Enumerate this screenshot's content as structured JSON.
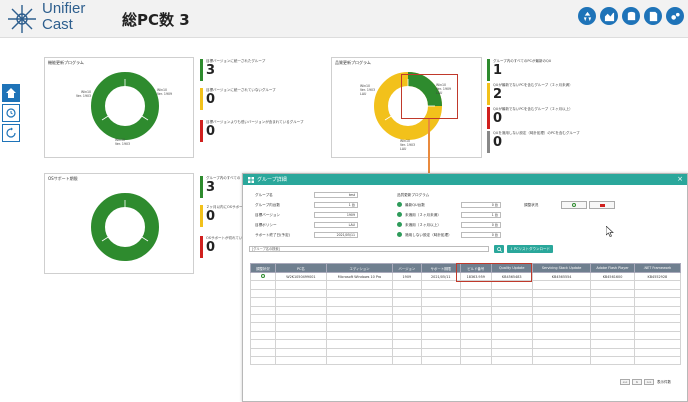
{
  "app": {
    "logo_line1": "Unifier",
    "logo_line2": "Cast",
    "title": "総PC数 3"
  },
  "top_icons": [
    "recycle-icon",
    "area-chart-icon",
    "database-icon",
    "document-icon",
    "gears-icon"
  ],
  "side_nav": [
    "home-icon",
    "sync-icon",
    "refresh-icon"
  ],
  "panels": {
    "feature": {
      "title": "機能更新プログラム",
      "labels": [
        "Win10\nVer. 1903",
        "Win10\nVer. 1909",
        "Win10\nVer. 1903"
      ],
      "stats": [
        {
          "label": "目標バージョンに統一されたグループ",
          "value": "3"
        },
        {
          "label": "目標バージョンに統一されていないグループ",
          "value": "0"
        },
        {
          "label": "目標バージョンよりも低いバージョンが含まれているグループ",
          "value": "0"
        }
      ]
    },
    "quality": {
      "title": "品質更新プログラム",
      "labels": [
        "Win10\nVer. 1903\nLAU",
        "Win10\nVer. 1909\nLAU",
        "Win10\nVer. 1903\nLAU"
      ],
      "stats": [
        {
          "label": "グループ内のすべてのPCが最新のQU",
          "value": "1"
        },
        {
          "label": "QUが最新でないPCを含むグループ（２ヶ月未満）",
          "value": "2"
        },
        {
          "label": "QUが最新でないPCを含むグループ（２ヶ月以上）",
          "value": "0"
        },
        {
          "label": "QUを適用しない設定（時計処理）のPCを含むグループ",
          "value": "0"
        }
      ]
    },
    "os": {
      "title": "OSサポート期限",
      "stats": [
        {
          "label": "グループ内のすべての",
          "value": "3"
        },
        {
          "label": "２ヶ月以内にOSサポー",
          "value": "0"
        },
        {
          "label": "OSサポートが切れてい",
          "value": "0"
        }
      ]
    }
  },
  "modal": {
    "title": "グループ詳細",
    "close": "×",
    "fields_left": [
      {
        "label": "グループ名",
        "value": "test"
      },
      {
        "label": "グループ内台数",
        "value": "1 台"
      },
      {
        "label": "目標バージョン",
        "value": "1909"
      },
      {
        "label": "目標ポリシー",
        "value": "LAU"
      },
      {
        "label": "サポート終了日(予定)",
        "value": "2021/05/11"
      }
    ],
    "fields_mid_heading": "品質更新プログラム",
    "fields_mid": [
      {
        "label": "最新QU台数",
        "value": "0 台"
      },
      {
        "label": "未適用（２ヶ月未満）",
        "value": "1 台"
      },
      {
        "label": "未適用（２ヶ月以上）",
        "value": "0 台"
      },
      {
        "label": "適用しない設定（時計処理）",
        "value": "0 台"
      }
    ],
    "schedule_label": "調整状況",
    "search_placeholder": "[グループ名の検索]",
    "download_label": "PCリストダウンロード",
    "table": {
      "headers": [
        "調整状況",
        "PC名",
        "エディション",
        "バージョン",
        "サポート期限",
        "ビルド番号",
        "Quality Update",
        "Servicing Stack Update",
        "Adobe Flash Player",
        ".NET Framework"
      ],
      "rows": [
        [
          "",
          "W2K1050499001",
          "Microsoft Windows 10 Pro",
          "1909",
          "2021/05/11",
          "18363.959",
          "KB4565483",
          "KB4565554",
          "KB4561600",
          "KB4552928"
        ]
      ],
      "empty_rows": 10
    },
    "pager": {
      "prev": "<<",
      "next": ">>",
      "page": "1",
      "per_page_label": "表示件数"
    }
  }
}
